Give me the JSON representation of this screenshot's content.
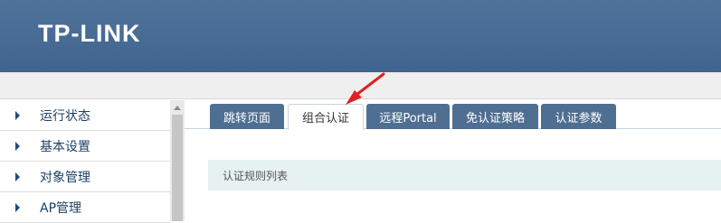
{
  "header": {
    "brand": "TP-LINK"
  },
  "sidebar": {
    "items": [
      {
        "label": "运行状态"
      },
      {
        "label": "基本设置"
      },
      {
        "label": "对象管理"
      },
      {
        "label": "AP管理"
      }
    ]
  },
  "tabs": [
    {
      "label": "跳转页面",
      "active": false
    },
    {
      "label": "组合认证",
      "active": true
    },
    {
      "label": "远程Portal",
      "active": false
    },
    {
      "label": "免认证策略",
      "active": false
    },
    {
      "label": "认证参数",
      "active": false
    }
  ],
  "section": {
    "title": "认证规则列表"
  },
  "colors": {
    "header": "#46698f",
    "tab": "#4f6f92",
    "section_bar": "#e6f2f1",
    "callout": "#e02020"
  }
}
